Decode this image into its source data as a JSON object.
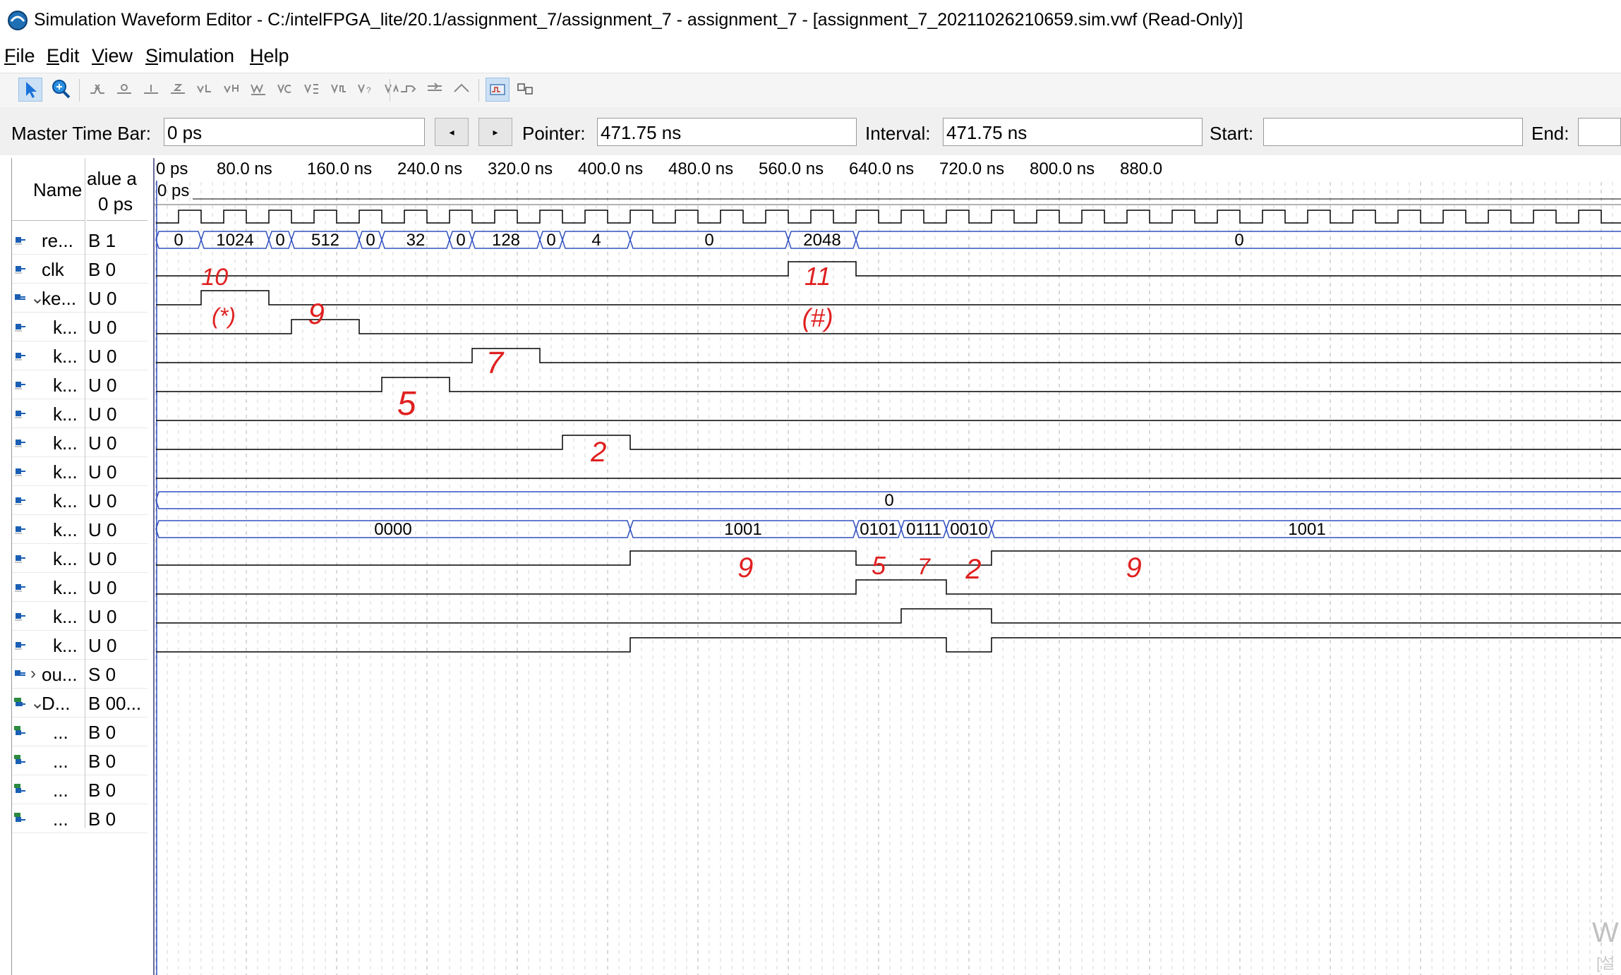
{
  "window": {
    "title": "Simulation Waveform Editor - C:/intelFPGA_lite/20.1/assignment_7/assignment_7 - assignment_7 - [assignment_7_20211026210659.sim.vwf (Read-Only)]"
  },
  "menu": [
    {
      "label": "File",
      "accel": "F",
      "rest": "ile"
    },
    {
      "label": "Edit",
      "accel": "E",
      "rest": "dit"
    },
    {
      "label": "View",
      "accel": "V",
      "rest": "iew"
    },
    {
      "label": "Simulation",
      "accel": "S",
      "rest": "imulation"
    },
    {
      "label": "Help",
      "accel": "H",
      "rest": "elp"
    }
  ],
  "timebar": {
    "master_label": "Master Time Bar:",
    "master_value": "0 ps",
    "prev_glyph": "◂",
    "next_glyph": "▸",
    "pointer_label": "Pointer:",
    "pointer_value": "471.75 ns",
    "interval_label": "Interval:",
    "interval_value": "471.75 ns",
    "start_label": "Start:",
    "start_value": "",
    "end_label": "End:",
    "end_value": ""
  },
  "columns": {
    "name": "Name",
    "value_line1": "alue a",
    "value_line2": "0 ps"
  },
  "signals": [
    {
      "name": "re...",
      "value": "B 1",
      "icon": "input-pin-icon",
      "indent": 0,
      "expander": ""
    },
    {
      "name": "clk",
      "value": "B 0",
      "icon": "input-pin-icon",
      "indent": 0,
      "expander": ""
    },
    {
      "name": "ke...",
      "value": "U 0",
      "icon": "input-bus-icon",
      "indent": 0,
      "expander": "⌄"
    },
    {
      "name": "k...",
      "value": "U 0",
      "icon": "input-pin-icon",
      "indent": 1,
      "expander": ""
    },
    {
      "name": "k...",
      "value": "U 0",
      "icon": "input-pin-icon",
      "indent": 1,
      "expander": ""
    },
    {
      "name": "k...",
      "value": "U 0",
      "icon": "input-pin-icon",
      "indent": 1,
      "expander": ""
    },
    {
      "name": "k...",
      "value": "U 0",
      "icon": "input-pin-icon",
      "indent": 1,
      "expander": ""
    },
    {
      "name": "k...",
      "value": "U 0",
      "icon": "input-pin-icon",
      "indent": 1,
      "expander": ""
    },
    {
      "name": "k...",
      "value": "U 0",
      "icon": "input-pin-icon",
      "indent": 1,
      "expander": ""
    },
    {
      "name": "k...",
      "value": "U 0",
      "icon": "input-pin-icon",
      "indent": 1,
      "expander": ""
    },
    {
      "name": "k...",
      "value": "U 0",
      "icon": "input-pin-icon",
      "indent": 1,
      "expander": ""
    },
    {
      "name": "k...",
      "value": "U 0",
      "icon": "input-pin-icon",
      "indent": 1,
      "expander": ""
    },
    {
      "name": "k...",
      "value": "U 0",
      "icon": "input-pin-icon",
      "indent": 1,
      "expander": ""
    },
    {
      "name": "k...",
      "value": "U 0",
      "icon": "input-pin-icon",
      "indent": 1,
      "expander": ""
    },
    {
      "name": "k...",
      "value": "U 0",
      "icon": "input-pin-icon",
      "indent": 1,
      "expander": ""
    },
    {
      "name": "ou...",
      "value": "S 0",
      "icon": "input-bus-icon",
      "indent": 0,
      "expander": "›"
    },
    {
      "name": "D...",
      "value": "B 00...",
      "icon": "output-bus-icon",
      "indent": 0,
      "expander": "⌄"
    },
    {
      "name": "...",
      "value": "B 0",
      "icon": "output-pin-icon",
      "indent": 1,
      "expander": ""
    },
    {
      "name": "...",
      "value": "B 0",
      "icon": "output-pin-icon",
      "indent": 1,
      "expander": ""
    },
    {
      "name": "...",
      "value": "B 0",
      "icon": "output-pin-icon",
      "indent": 1,
      "expander": ""
    },
    {
      "name": "...",
      "value": "B 0",
      "icon": "output-pin-icon",
      "indent": 1,
      "expander": ""
    }
  ],
  "ruler": {
    "ticks": [
      "0 ps",
      "80.0 ns",
      "160.0 ns",
      "240.0 ns",
      "320.0 ns",
      "400.0 ns",
      "480.0 ns",
      "560.0 ns",
      "640.0 ns",
      "720.0 ns",
      "800.0 ns",
      "880.0"
    ],
    "master_marker": "0 ps"
  },
  "bus_labels": {
    "reg": [
      "0",
      "1024",
      "0",
      "512",
      "0",
      "32",
      "0",
      "128",
      "0",
      "4",
      "0",
      "2048",
      "0"
    ],
    "row_out": [
      "0"
    ],
    "row_d": [
      "0000",
      "1001",
      "0101",
      "0111",
      "0010",
      "1001"
    ]
  },
  "annotations": [
    "10",
    "(*)",
    "9",
    "5",
    "7",
    "2",
    "11",
    "(#)",
    "9",
    "5",
    "7",
    "2",
    "9"
  ],
  "watermark": "W",
  "watermark2": "[설"
}
